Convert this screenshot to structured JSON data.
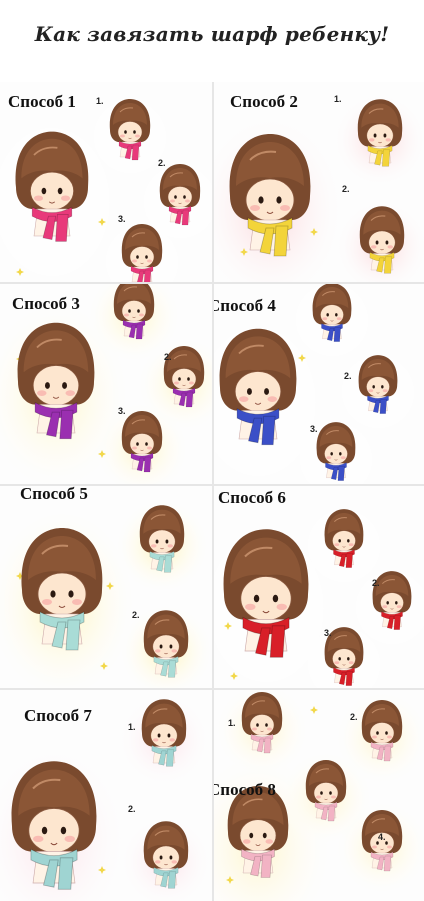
{
  "title": "Как завязать шарф ребенку!",
  "methods": [
    {
      "label": "Способ 1",
      "color": "#e8397a",
      "glow": "#ffffff",
      "steps": [
        "1.",
        "2.",
        "3."
      ]
    },
    {
      "label": "Способ 2",
      "color": "#f3d43a",
      "glow": "#fbd6d9",
      "steps": [
        "1.",
        "2."
      ]
    },
    {
      "label": "Способ 3",
      "color": "#9a2fb0",
      "glow": "#fff6c8",
      "steps": [
        "2.",
        "3."
      ]
    },
    {
      "label": "Способ 4",
      "color": "#3b4fc7",
      "glow": "#ffffff",
      "steps": [
        "2.",
        "3."
      ]
    },
    {
      "label": "Способ 5",
      "color": "#a9dcd6",
      "glow": "#fff4b8",
      "steps": [
        "2."
      ]
    },
    {
      "label": "Способ 6",
      "color": "#d81f28",
      "glow": "#ffffff",
      "steps": [
        "2.",
        "3."
      ]
    },
    {
      "label": "Способ 7",
      "color": "#9fd4d2",
      "glow": "#fbe1e8",
      "steps": [
        "1.",
        "2."
      ]
    },
    {
      "label": "Способ 8",
      "color": "#f2b3c4",
      "glow": "#fff5cc",
      "steps": [
        "1.",
        "2.",
        "4."
      ]
    }
  ]
}
